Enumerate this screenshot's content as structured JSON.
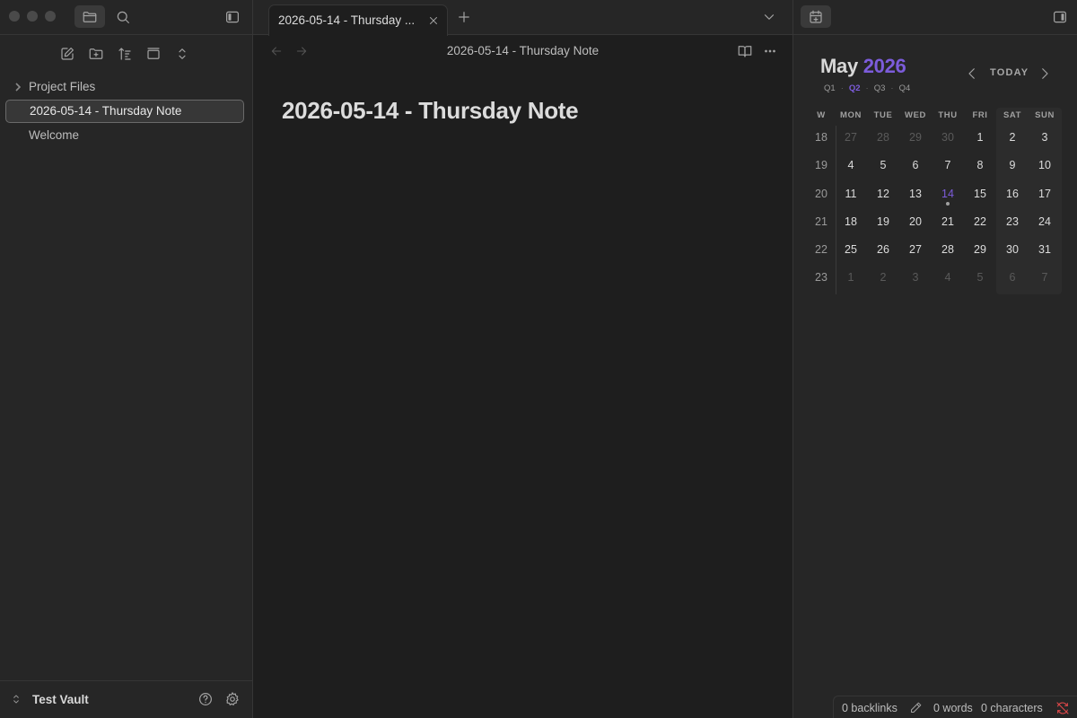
{
  "sidebar_left": {
    "tree": {
      "folder": "Project Files",
      "items": [
        "2026-05-14 - Thursday Note",
        "Welcome"
      ],
      "active_index": 0
    },
    "vault_name": "Test Vault"
  },
  "tabs": {
    "active_title": "2026-05-14 - Thursday ..."
  },
  "view": {
    "header_title": "2026-05-14 - Thursday Note",
    "note_title": "2026-05-14 - Thursday Note"
  },
  "calendar": {
    "month": "May",
    "year": "2026",
    "today_label": "TODAY",
    "quarters": [
      "Q1",
      "Q2",
      "Q3",
      "Q4"
    ],
    "active_quarter": "Q2",
    "headers": [
      "W",
      "MON",
      "TUE",
      "WED",
      "THU",
      "FRI",
      "SAT",
      "SUN"
    ],
    "weeks": [
      {
        "wk": "18",
        "days": [
          [
            "27",
            1
          ],
          [
            "28",
            1
          ],
          [
            "29",
            1
          ],
          [
            "30",
            1
          ],
          [
            "1",
            0
          ],
          [
            "2",
            0
          ],
          [
            "3",
            0
          ]
        ]
      },
      {
        "wk": "19",
        "days": [
          [
            "4",
            0
          ],
          [
            "5",
            0
          ],
          [
            "6",
            0
          ],
          [
            "7",
            0
          ],
          [
            "8",
            0
          ],
          [
            "9",
            0
          ],
          [
            "10",
            0
          ]
        ]
      },
      {
        "wk": "20",
        "days": [
          [
            "11",
            0
          ],
          [
            "12",
            0
          ],
          [
            "13",
            0
          ],
          [
            "14",
            2
          ],
          [
            "15",
            0
          ],
          [
            "16",
            0
          ],
          [
            "17",
            0
          ]
        ]
      },
      {
        "wk": "21",
        "days": [
          [
            "18",
            0
          ],
          [
            "19",
            0
          ],
          [
            "20",
            0
          ],
          [
            "21",
            0
          ],
          [
            "22",
            0
          ],
          [
            "23",
            0
          ],
          [
            "24",
            0
          ]
        ]
      },
      {
        "wk": "22",
        "days": [
          [
            "25",
            0
          ],
          [
            "26",
            0
          ],
          [
            "27",
            0
          ],
          [
            "28",
            0
          ],
          [
            "29",
            0
          ],
          [
            "30",
            0
          ],
          [
            "31",
            0
          ]
        ]
      },
      {
        "wk": "23",
        "days": [
          [
            "1",
            1
          ],
          [
            "2",
            1
          ],
          [
            "3",
            1
          ],
          [
            "4",
            1
          ],
          [
            "5",
            1
          ],
          [
            "6",
            1
          ],
          [
            "7",
            1
          ]
        ]
      }
    ],
    "accent_color": "#7c5cdb"
  },
  "statusbar": {
    "backlinks": "0 backlinks",
    "words": "0 words",
    "characters": "0 characters"
  },
  "icons": {
    "files": "folder-icon",
    "search": "search-icon",
    "calendar": "calendar-icon",
    "sync": "sync-off-icon"
  }
}
